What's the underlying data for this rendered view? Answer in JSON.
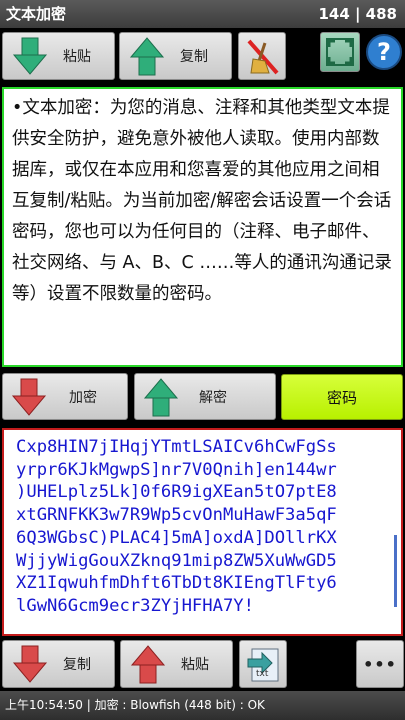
{
  "titlebar": {
    "title": "文本加密",
    "counter": "144 | 488"
  },
  "toolbar_top": {
    "paste_label": "粘贴",
    "copy_label": "复制"
  },
  "plaintext": "•文本加密：为您的消息、注释和其他类型文本提供安全防护，避免意外被他人读取。使用内部数据库，或仅在本应用和您喜爱的其他应用之间相互复制/粘贴。为当前加密/解密会话设置一个会话密码，您也可以为任何目的（注释、电子邮件、社交网络、与 A、B、C ……等人的通讯沟通记录等）设置不限数量的密码。",
  "middle": {
    "encrypt_label": "加密",
    "decrypt_label": "解密",
    "password_label": "密码"
  },
  "ciphertext": "Cxp8HIN7jIHqjYTmtLSAICv6hCwFgSs\nyrpr6KJkMgwpS]nr7V0Qnih]en144wr\n)UHELplz5Lk]0f6R9igXEan5tO7ptE8\nxtGRNFKK3w7R9Wp5cvOnMuHawF3a5qF\n6Q3WGbsC)PLAC4]5mA]oxdA]DOllrKX\nWjjyWigGouXZknq91mip8ZW5XuWwGD5\nXZ1IqwuhfmDhft6TbDt8KIEngTlFty6\nlGwN6Gcm9ecr3ZYjHFHA7Y!",
  "toolbar_bottom": {
    "copy_label": "复制",
    "paste_label": "粘贴",
    "txt_label": "txt",
    "more_label": "•••"
  },
  "status": "上午10:54:50 | 加密 : Blowfish (448 bit) : OK",
  "colors": {
    "plaintext_border": "#29d829",
    "cipher_border": "#c41c1c",
    "cipher_text": "#1717d0",
    "password_button": "#c8f81c",
    "down_arrow_green": "#2fae7a",
    "up_arrow_green": "#2fae7a",
    "down_arrow_red": "#d94a4a"
  }
}
